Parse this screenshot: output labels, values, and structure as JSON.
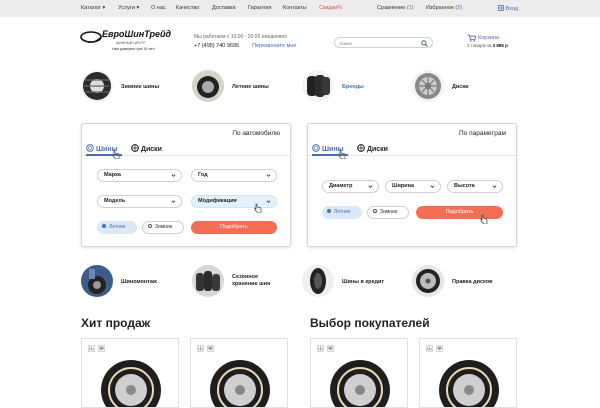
{
  "nav": {
    "items": [
      "Каталог",
      "Услуги",
      "О нас",
      "Качество",
      "Доставка",
      "Гарантия",
      "Контакты",
      "Скидки%"
    ],
    "compare_label": "Сравнение",
    "compare_count": "(1)",
    "favorites_label": "Избранное",
    "favorites_count": "(2)",
    "login_label": "Вход"
  },
  "header": {
    "logo_text": "ЕвроШинТрейд",
    "logo_sub": "ШИННЫЙ ЦЕНТР",
    "logo_tagline": "Нам доверяют уже 16 лет!",
    "hours": "Мы работаем с 10:00 - 20:00 ежедневно",
    "phone": "+7 (495) 740 9695",
    "callback": "Перезвоните мне",
    "search_placeholder": "поиск",
    "cart_title": "Корзина",
    "cart_info": "2 товара на",
    "cart_sum": "3 885 р"
  },
  "categories": [
    "Зимние шины",
    "Летние шины",
    "Бренды",
    "Диски"
  ],
  "filter_car": {
    "title": "По автомобилю",
    "tab_tires": "Шины",
    "tab_disks": "Диски",
    "make": "Марка",
    "year": "Год",
    "model": "Модель",
    "modification": "Модификация",
    "summer": "Летние",
    "winter": "Зимние",
    "submit": "Подобрать"
  },
  "filter_params": {
    "title": "По параметрам",
    "tab_tires": "Шины",
    "tab_disks": "Диски",
    "diameter": "Диаметр",
    "width": "Ширина",
    "height": "Высота",
    "summer": "Летние",
    "winter": "Зимние",
    "submit": "Подобрать"
  },
  "services": {
    "fitting": "Шиномонтаж",
    "storage_1": "Сезонное",
    "storage_2": "хранение шин",
    "credit": "Шины в кредит",
    "repair": "Правка дисков"
  },
  "sections": {
    "hits": "Хит продаж",
    "choice": "Выбор покупателей"
  },
  "colors": {
    "accent": "#4a6fb0",
    "button": "#f36e55",
    "sale": "#e0533b"
  }
}
